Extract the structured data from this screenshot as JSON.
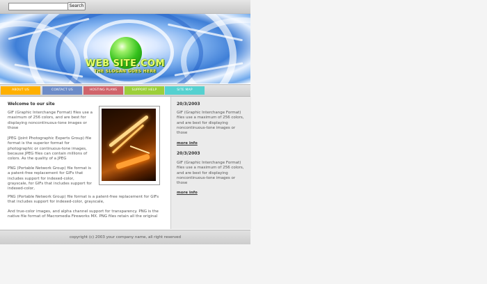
{
  "search": {
    "value": "",
    "placeholder": "",
    "button_label": "Search"
  },
  "banner": {
    "title": "WEB SITE.COM",
    "slogan": "THE SLOGAN GOES HERE"
  },
  "nav": {
    "tabs": [
      {
        "label": "ABOUT US",
        "color": "#ffb000"
      },
      {
        "label": "CONTACT US",
        "color": "#6d8cc8"
      },
      {
        "label": "HOSTING PLANS",
        "color": "#d0646b"
      },
      {
        "label": "SUPPORT HELP",
        "color": "#9ccf3a"
      },
      {
        "label": "SITE MAP",
        "color": "#55d1d0"
      }
    ]
  },
  "main": {
    "welcome_title": "Welcome to our site",
    "paragraphs": [
      "GIF (Graphic Interchange Format) files use a maximum of 256 colors, and are best for displaying noncontinuous-tone images or those",
      "JPEG (Joint Photographic Experts Group) file format is the superior format for photographic or continuous-tone images, because JPEG files can contain millions of colors. As the quality of a JPEG",
      "PNG (Portable Network Group) file format is a patent-free replacement for GIFs that includes support for indexed-color, grayscale, for GIFs that includes support for indexed-color,",
      "PNG (Portable Network Group) file format is a patent-free replacement for GIFs that includes support for indexed-color, grayscale,",
      "And true-color images, and alpha channel support for transparency. PNG is the native file format of Macromedia Fireworks MX. PNG files retain all the original"
    ]
  },
  "news": [
    {
      "date": "20/3/2003",
      "body": "GIF (Graphic Interchange Format) files use a maximum of 256 colors, and are best for displaying noncontinuous-tone images or those",
      "link": "more info"
    },
    {
      "date": "20/3/2003",
      "body": "GIF (Graphic Interchange Format) files use a maximum of 256 colors, and are best for displaying noncontinuous-tone images or those",
      "link": "more info"
    }
  ],
  "footer": {
    "copyright": "copyright (c) 2003 your company name, all right reserved"
  }
}
